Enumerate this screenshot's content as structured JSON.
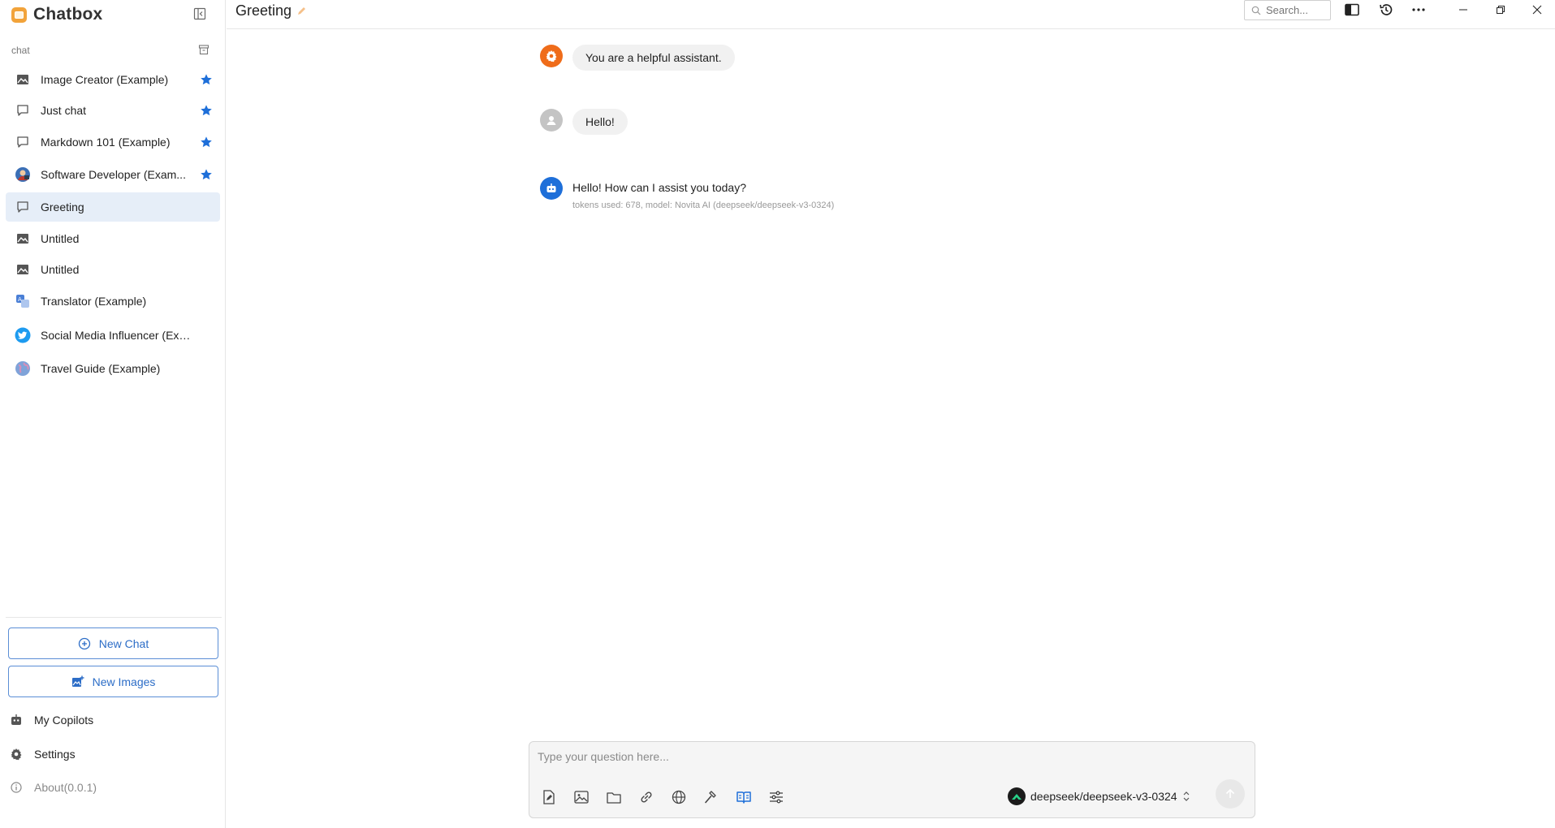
{
  "app": {
    "name": "Chatbox"
  },
  "sidebar": {
    "section_label": "chat",
    "sessions": [
      {
        "label": "Image Creator (Example)",
        "icon": "image-icon",
        "starred": true
      },
      {
        "label": "Just chat",
        "icon": "chat-bubble-icon",
        "starred": true
      },
      {
        "label": "Markdown 101 (Example)",
        "icon": "chat-bubble-icon",
        "starred": true
      },
      {
        "label": "Software Developer (Exam...",
        "icon": "developer-avatar-icon",
        "starred": true
      },
      {
        "label": "Greeting",
        "icon": "chat-bubble-icon",
        "starred": false,
        "active": true
      },
      {
        "label": "Untitled",
        "icon": "image-icon",
        "starred": false
      },
      {
        "label": "Untitled",
        "icon": "image-icon",
        "starred": false
      },
      {
        "label": "Translator (Example)",
        "icon": "translator-avatar-icon",
        "starred": false
      },
      {
        "label": "Social Media Influencer (Example)",
        "icon": "twitter-avatar-icon",
        "starred": false
      },
      {
        "label": "Travel Guide (Example)",
        "icon": "globe-avatar-icon",
        "starred": false
      }
    ],
    "new_chat_label": "New Chat",
    "new_images_label": "New Images",
    "my_copilots_label": "My Copilots",
    "settings_label": "Settings",
    "about_label": "About(0.0.1)"
  },
  "header": {
    "title": "Greeting",
    "search_placeholder": "Search..."
  },
  "messages": [
    {
      "role": "system",
      "text": "You are a helpful assistant."
    },
    {
      "role": "user",
      "text": "Hello!"
    },
    {
      "role": "assistant",
      "text": "Hello! How can I assist you today?",
      "meta": "tokens used: 678, model: Novita AI (deepseek/deepseek-v3-0324)"
    }
  ],
  "composer": {
    "placeholder": "Type your question here...",
    "model": "deepseek/deepseek-v3-0324",
    "value": ""
  },
  "colors": {
    "accent": "#2c6dc7",
    "star": "#1e6fd9",
    "system_avatar": "#ef6c1a",
    "user_avatar": "#c4c4c4",
    "assistant_avatar": "#1e6fd9",
    "active_session": "#e6eef8"
  }
}
